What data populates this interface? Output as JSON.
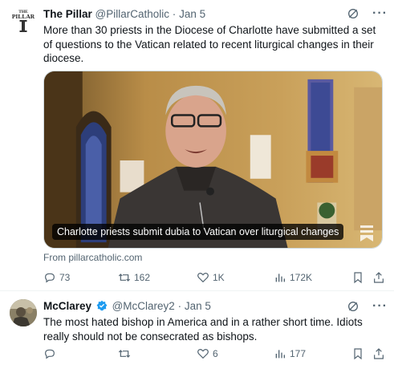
{
  "tweets": [
    {
      "name": "The Pillar",
      "handle": "@PillarCatholic",
      "dot": "·",
      "date": "Jan 5",
      "text": "More than 30 priests in the Diocese of Charlotte have submitted a set of questions to the Vatican related to recent liturgical changes in their diocese.",
      "avatar_text": "THE PILLAR",
      "card": {
        "caption": "Charlotte priests submit dubia to Vatican over liturgical changes",
        "source": "From pillarcatholic.com"
      },
      "actions": {
        "replies": "73",
        "reposts": "162",
        "likes": "1K",
        "views": "172K"
      },
      "icons": [
        "grok-icon",
        "more-icon",
        "reply-icon",
        "repost-icon",
        "like-icon",
        "views-icon",
        "bookmark-icon",
        "share-icon"
      ]
    },
    {
      "name": "McClarey",
      "handle": "@McClarey2",
      "dot": "·",
      "date": "Jan 5",
      "verified": true,
      "text": "The most hated bishop in America and in a rather short time.  Idiots really should not be consecrated as bishops.",
      "actions": {
        "replies": "",
        "reposts": "",
        "likes": "6",
        "views": "177"
      }
    }
  ],
  "colors": {
    "text": "#0f1419",
    "secondary": "#536471",
    "verified": "#1d9bf0",
    "border": "#cfd9de"
  }
}
